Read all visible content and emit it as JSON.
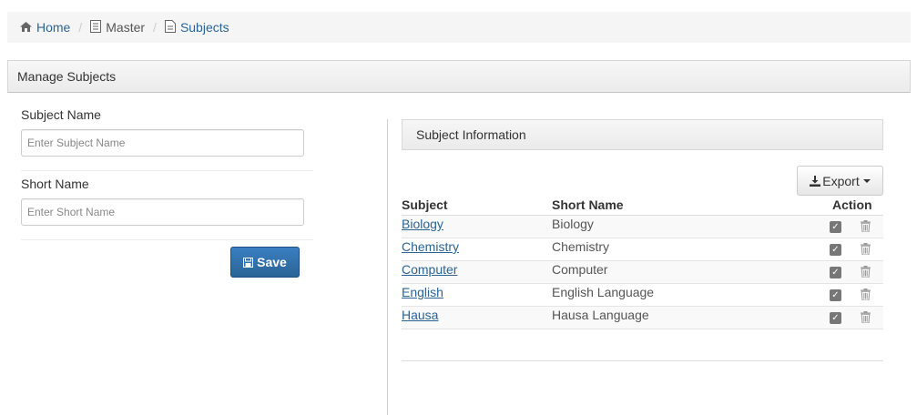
{
  "breadcrumb": {
    "home": "Home",
    "master": "Master",
    "subjects": "Subjects"
  },
  "panel": {
    "title": "Manage Subjects"
  },
  "form": {
    "subject_name_label": "Subject Name",
    "subject_name_placeholder": "Enter Subject Name",
    "short_name_label": "Short Name",
    "short_name_placeholder": "Enter Short Name",
    "save_label": "Save"
  },
  "info": {
    "title": "Subject Information",
    "export_label": "Export",
    "headers": {
      "subject": "Subject",
      "short_name": "Short Name",
      "action": "Action"
    },
    "rows": [
      {
        "subject": "Biology",
        "short_name": "Biology"
      },
      {
        "subject": "Chemistry",
        "short_name": "Chemistry"
      },
      {
        "subject": "Computer",
        "short_name": "Computer"
      },
      {
        "subject": "English",
        "short_name": "English Language"
      },
      {
        "subject": "Hausa",
        "short_name": "Hausa Language"
      }
    ]
  },
  "colors": {
    "link": "#2a6496",
    "primary_button": "#2a6496"
  },
  "icons": [
    "home-icon",
    "list-icon",
    "file-icon",
    "save-icon",
    "download-icon",
    "check-icon",
    "trash-icon"
  ]
}
